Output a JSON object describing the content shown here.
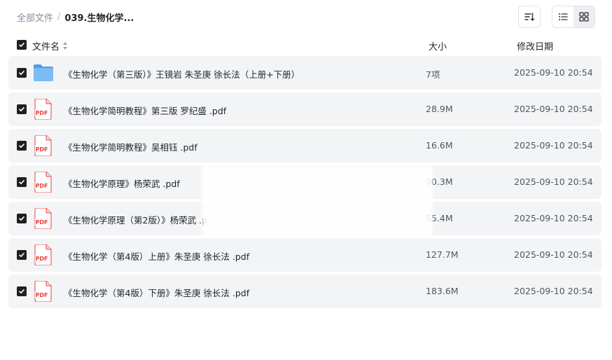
{
  "breadcrumb": {
    "root": "全部文件",
    "separator": "/",
    "current": "039.生物化学..."
  },
  "toolbar": {
    "sort_icon": "sort-icon",
    "list_view_icon": "list-view-icon",
    "grid_view_icon": "grid-view-icon",
    "active_view": "list"
  },
  "columns": {
    "name": "文件名",
    "size": "大小",
    "date": "修改日期"
  },
  "files": [
    {
      "type": "folder",
      "name": "《生物化学（第三版）》王镜岩 朱圣庚 徐长法（上册+下册）",
      "size": "7项",
      "date": "2025-09-10 20:54",
      "checked": true
    },
    {
      "type": "pdf",
      "name": "《生物化学简明教程》第三版 罗纪盛 .pdf",
      "size": "28.9M",
      "date": "2025-09-10 20:54",
      "checked": true
    },
    {
      "type": "pdf",
      "name": "《生物化学简明教程》吴相钰 .pdf",
      "size": "16.6M",
      "date": "2025-09-10 20:54",
      "checked": true
    },
    {
      "type": "pdf",
      "name": "《生物化学原理》杨荣武 .pdf",
      "size": "00.3M",
      "date": "2025-09-10 20:54",
      "checked": true
    },
    {
      "type": "pdf",
      "name": "《生物化学原理（第2版）》杨荣武 .p",
      "size": "55.4M",
      "date": "2025-09-10 20:54",
      "checked": true
    },
    {
      "type": "pdf",
      "name": "《生物化学（第4版）上册》朱圣庚 徐长法 .pdf",
      "size": "127.7M",
      "date": "2025-09-10 20:54",
      "checked": true
    },
    {
      "type": "pdf",
      "name": "《生物化学（第4版）下册》朱圣庚 徐长法 .pdf",
      "size": "183.6M",
      "date": "2025-09-10 20:54",
      "checked": true
    }
  ],
  "pdf_badge": "PDF",
  "colors": {
    "row_bg": "#f3f4f6",
    "folder": "#5aa9f0",
    "pdf_red": "#e8413c",
    "checkbox": "#1f1f1f"
  }
}
